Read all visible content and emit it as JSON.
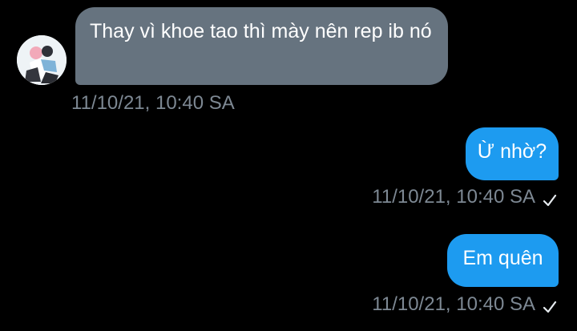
{
  "conversation": {
    "messages": [
      {
        "direction": "incoming",
        "text": "Thay vì khoe tao thì mày nên rep ib nó",
        "timestamp": "11/10/21, 10:40 SA"
      },
      {
        "direction": "outgoing",
        "text": "Ừ nhờ?",
        "timestamp": "11/10/21, 10:40 SA",
        "status": "sent"
      },
      {
        "direction": "outgoing",
        "text": "Em quên",
        "timestamp": "11/10/21, 10:40 SA",
        "status": "sent"
      }
    ]
  },
  "icons": {
    "avatar": "user-avatar",
    "sent_status": "checkmark-icon"
  },
  "colors": {
    "background": "#000000",
    "incoming_bubble": "#66737f",
    "outgoing_bubble": "#1d9bf0",
    "timestamp": "#7d8893"
  }
}
